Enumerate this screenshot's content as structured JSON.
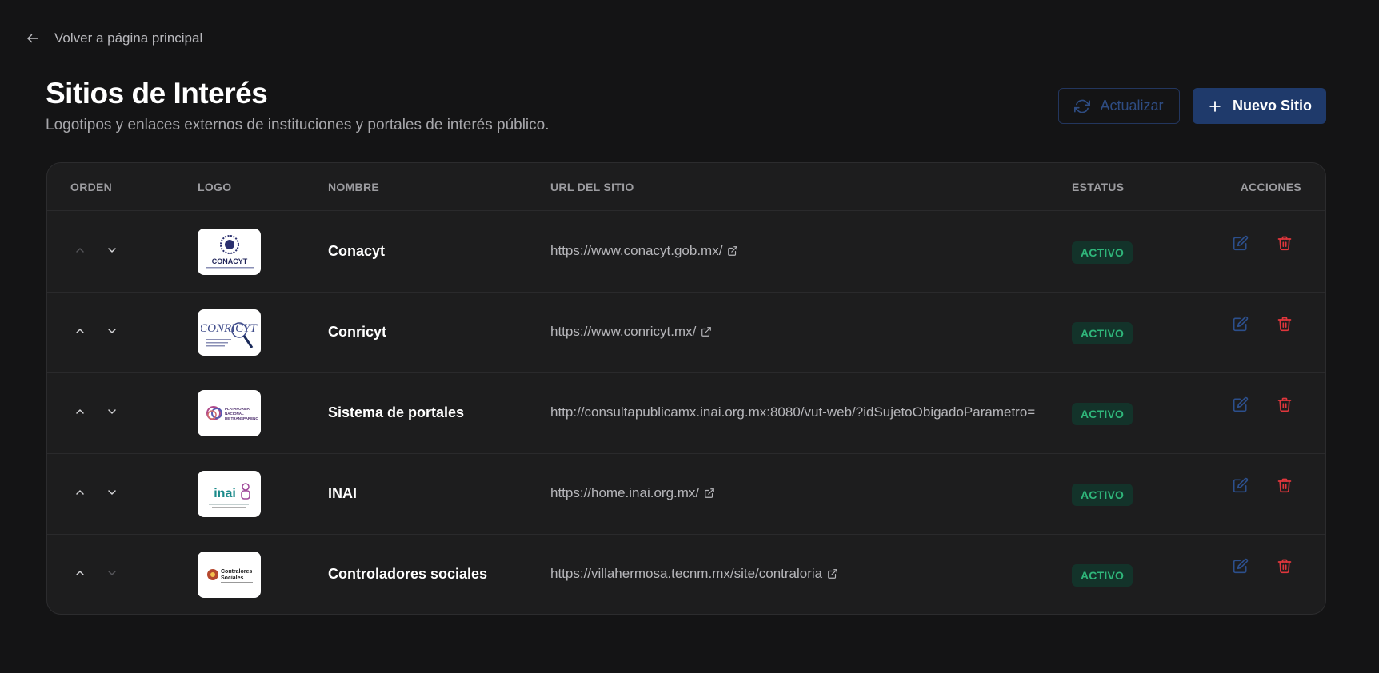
{
  "nav": {
    "back_label": "Volver a página principal"
  },
  "header": {
    "title": "Sitios de Interés",
    "subtitle": "Logotipos y enlaces externos de instituciones y portales de interés público.",
    "refresh_label": "Actualizar",
    "new_label": "Nuevo Sitio"
  },
  "table": {
    "columns": {
      "order": "ORDEN",
      "logo": "LOGO",
      "name": "NOMBRE",
      "url": "URL DEL SITIO",
      "status": "ESTATUS",
      "actions": "ACCIONES"
    },
    "rows": [
      {
        "name": "Conacyt",
        "url": "https://www.conacyt.gob.mx/",
        "status": "ACTIVO",
        "logo_text": "CONACYT",
        "up_enabled": false,
        "down_enabled": true,
        "url_truncated": false
      },
      {
        "name": "Conricyt",
        "url": "https://www.conricyt.mx/",
        "status": "ACTIVO",
        "logo_text": "CONRICYT",
        "up_enabled": true,
        "down_enabled": true,
        "url_truncated": false
      },
      {
        "name": "Sistema de portales",
        "url": "http://consultapublicamx.inai.org.mx:8080/vut-web/?idSujetoObigadoParametro=",
        "status": "ACTIVO",
        "logo_text": "PLATAFORMA NACIONAL DE TRANSPARENCIA",
        "up_enabled": true,
        "down_enabled": true,
        "url_truncated": true
      },
      {
        "name": "INAI",
        "url": "https://home.inai.org.mx/",
        "status": "ACTIVO",
        "logo_text": "inai",
        "up_enabled": true,
        "down_enabled": true,
        "url_truncated": false
      },
      {
        "name": "Controladores sociales",
        "url": "https://villahermosa.tecnm.mx/site/contraloria",
        "status": "ACTIVO",
        "logo_text": "Contralores Sociales",
        "up_enabled": true,
        "down_enabled": false,
        "url_truncated": false
      }
    ]
  },
  "colors": {
    "background": "#141415",
    "card": "#1d1d1e",
    "primary": "#1f3a6b",
    "status_active_bg": "#13332a",
    "status_active_text": "#2fb67a",
    "delete": "#e0363c",
    "edit": "#2c4f8c"
  }
}
